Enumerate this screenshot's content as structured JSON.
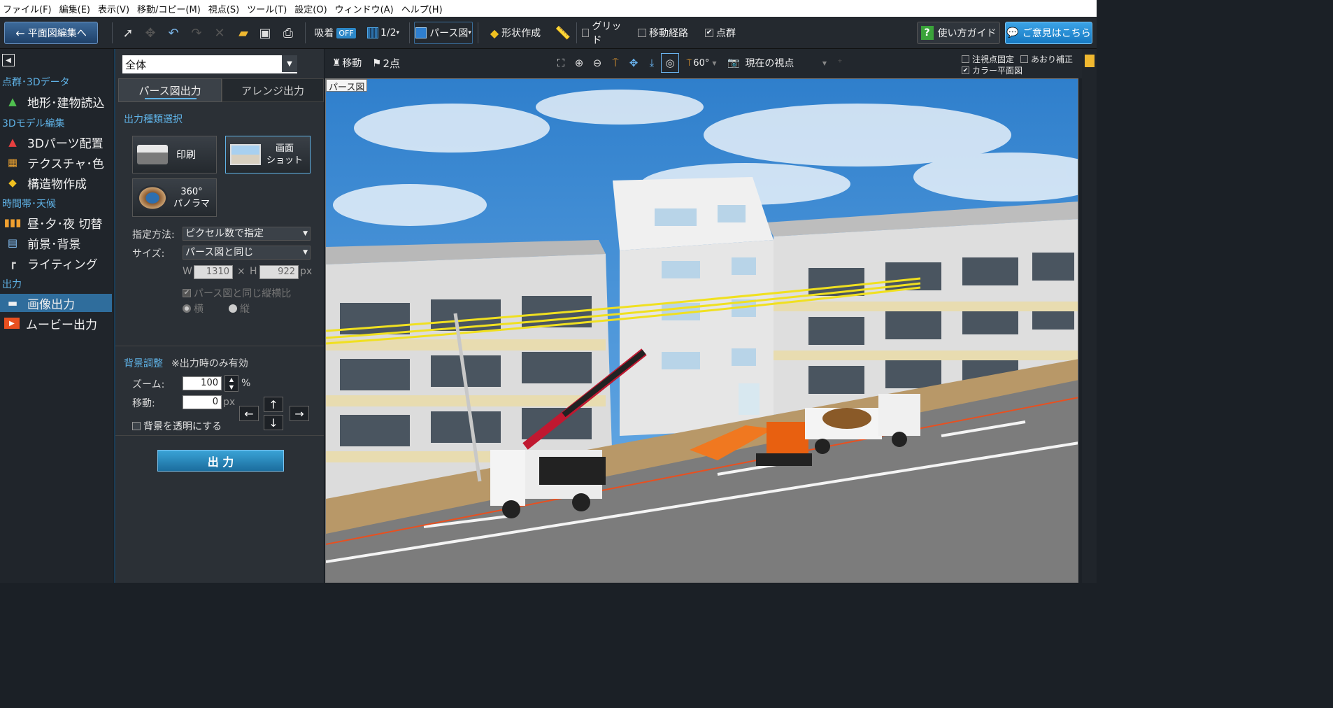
{
  "menu": [
    "ファイル(F)",
    "編集(E)",
    "表示(V)",
    "移動/コピー(M)",
    "視点(S)",
    "ツール(T)",
    "設定(O)",
    "ウィンドウ(A)",
    "ヘルプ(H)"
  ],
  "toolbar": {
    "back_label": "平面図編集へ",
    "snap_label": "吸着",
    "snap_state": "OFF",
    "grid_ratio": "1/2",
    "view_mode": "パース図",
    "shape_label": "形状作成",
    "grid_label": "グリッド",
    "route_label": "移動経路",
    "pointcloud_label": "点群",
    "guide_label": "使い方ガイド",
    "opinion_label": "ご意見はこちら"
  },
  "sidebar": {
    "sections": [
      "点群･3Dデータ",
      "3Dモデル編集",
      "時間帯･天候",
      "出力"
    ],
    "items": [
      "地形･建物読込",
      "3Dパーツ配置",
      "テクスチャ･色",
      "構造物作成",
      "昼･夕･夜 切替",
      "前景･背景",
      "ライティング",
      "画像出力",
      "ムービー出力"
    ]
  },
  "panel": {
    "scope": "全体",
    "tabs": [
      "パース図出力",
      "アレンジ出力"
    ],
    "output_type_heading": "出力種類選択",
    "btn_print": "印刷",
    "btn_shot_l1": "画面",
    "btn_shot_l2": "ショット",
    "btn_pano_l1": "360°",
    "btn_pano_l2": "パノラマ",
    "method_label": "指定方法:",
    "method_value": "ピクセル数で指定",
    "size_label": "サイズ:",
    "size_value": "パース図と同じ",
    "w_label": "W",
    "w_value": "1310",
    "times": "×",
    "h_label": "H",
    "h_value": "922",
    "px": "px",
    "aspect_label": "パース図と同じ縦横比",
    "orient_h": "横",
    "orient_v": "縦",
    "bg_heading": "背景調整",
    "bg_note": "※出力時のみ有効",
    "zoom_label": "ズーム:",
    "zoom_value": "100",
    "percent": "%",
    "move_label": "移動:",
    "move_value": "0",
    "transparent_label": "背景を透明にする",
    "output_button": "出 力"
  },
  "view": {
    "move_label": "移動",
    "twopoint_label": "2点",
    "fov_label": "60°",
    "viewpoint_label": "現在の視点",
    "fixed_label": "注視点固定",
    "tilt_label": "あおり補正",
    "colorplan_label": "カラー平面図",
    "caption": "パース図"
  },
  "colors": {
    "accent": "#2f6d9c",
    "section": "#5fb2e6",
    "sky": "#3b8fd6",
    "road": "#7c7c7c"
  }
}
